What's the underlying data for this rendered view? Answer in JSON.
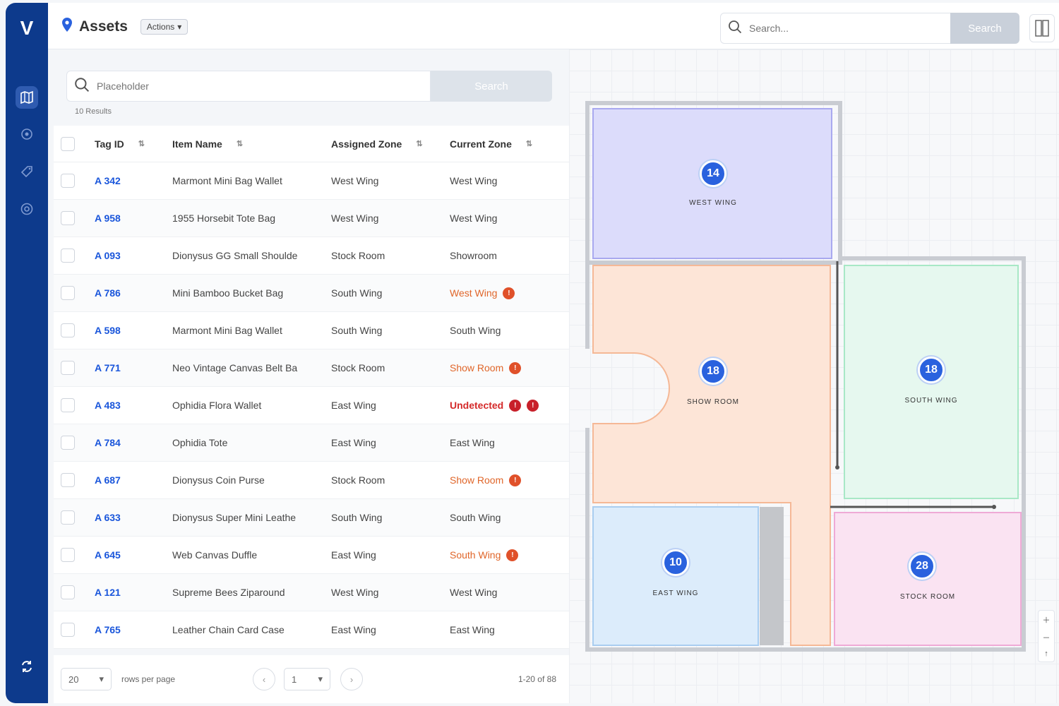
{
  "app": {
    "logo": "V"
  },
  "header": {
    "title": "Assets",
    "actions_label": "Actions",
    "search_placeholder": "Search...",
    "search_button": "Search"
  },
  "table_panel": {
    "search_placeholder": "Placeholder",
    "search_button": "Search",
    "results_text": "10 Results",
    "columns": [
      "Tag ID",
      "Item Name",
      "Assigned Zone",
      "Current Zone"
    ],
    "rows": [
      {
        "tag": "A 342",
        "name": "Marmont Mini Bag Wallet",
        "assigned": "West Wing",
        "current": "West Wing",
        "status": "ok"
      },
      {
        "tag": "A 958",
        "name": "1955 Horsebit Tote Bag",
        "assigned": "West Wing",
        "current": "West Wing",
        "status": "ok"
      },
      {
        "tag": "A 093",
        "name": "Dionysus GG Small Shoulde",
        "assigned": "Stock Room",
        "current": "Showroom",
        "status": "ok"
      },
      {
        "tag": "A 786",
        "name": "Mini Bamboo Bucket Bag",
        "assigned": "South Wing",
        "current": "West Wing",
        "status": "warn"
      },
      {
        "tag": "A 598",
        "name": "Marmont Mini Bag Wallet",
        "assigned": "South Wing",
        "current": "South Wing",
        "status": "ok"
      },
      {
        "tag": "A 771",
        "name": "Neo Vintage Canvas Belt Ba",
        "assigned": "Stock Room",
        "current": "Show Room",
        "status": "warn"
      },
      {
        "tag": "A 483",
        "name": "Ophidia Flora Wallet",
        "assigned": "East Wing",
        "current": "Undetected",
        "status": "alert"
      },
      {
        "tag": "A 784",
        "name": "Ophidia Tote",
        "assigned": "East Wing",
        "current": "East Wing",
        "status": "ok"
      },
      {
        "tag": "A 687",
        "name": "Dionysus Coin Purse",
        "assigned": "Stock Room",
        "current": "Show Room",
        "status": "warn"
      },
      {
        "tag": "A 633",
        "name": "Dionysus Super Mini Leathe",
        "assigned": "South Wing",
        "current": "South Wing",
        "status": "ok"
      },
      {
        "tag": "A 645",
        "name": "Web Canvas Duffle",
        "assigned": "East Wing",
        "current": "South Wing",
        "status": "warn"
      },
      {
        "tag": "A 121",
        "name": "Supreme Bees Ziparound",
        "assigned": "West Wing",
        "current": "West Wing",
        "status": "ok"
      },
      {
        "tag": "A 765",
        "name": "Leather Chain Card Case",
        "assigned": "East Wing",
        "current": "East Wing",
        "status": "ok"
      }
    ],
    "pager": {
      "rows_per_page": "20",
      "rows_per_page_label": "rows per page",
      "page": "1",
      "range": "1-20 of 88"
    }
  },
  "map": {
    "zones": [
      {
        "label": "WEST WING",
        "count": "14",
        "color": "#dcdcfb"
      },
      {
        "label": "SHOW ROOM",
        "count": "18",
        "color": "#fde5d7"
      },
      {
        "label": "SOUTH WING",
        "count": "18",
        "color": "#e6f8ef"
      },
      {
        "label": "EAST WING",
        "count": "10",
        "color": "#dcecfb"
      },
      {
        "label": "STOCK ROOM",
        "count": "28",
        "color": "#fae3f2"
      }
    ]
  },
  "colors": {
    "rail": "#0d3a8c",
    "accent": "#2a62de",
    "warning": "#e0662a",
    "alert": "#d42a2a"
  }
}
